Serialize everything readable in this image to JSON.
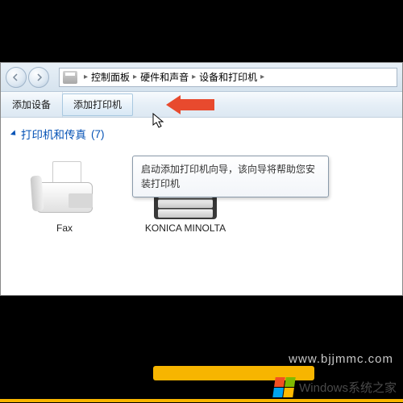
{
  "breadcrumb": {
    "items": [
      "控制面板",
      "硬件和声音",
      "设备和打印机"
    ]
  },
  "toolbar": {
    "add_device": "添加设备",
    "add_printer": "添加打印机"
  },
  "section": {
    "title_prefix": "打印机和传真",
    "count": "(7)"
  },
  "tooltip": {
    "text": "启动添加打印机向导，该向导将帮助您安装打印机"
  },
  "devices": [
    {
      "label": "Fax"
    },
    {
      "label": "KONICA MINOLTA"
    }
  ],
  "watermark": {
    "brand": "Windows系统之家",
    "url": "www.bjjmmc.com"
  }
}
